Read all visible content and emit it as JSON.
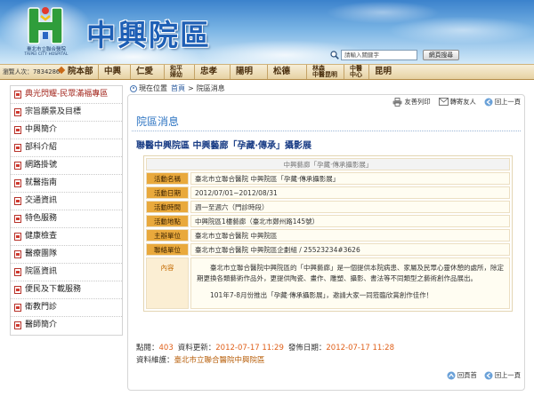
{
  "header": {
    "logo_text_zh": "臺北市立聯合醫院",
    "logo_text_en": "TAIPEI CITY HOSPITAL",
    "site_title": "中興院區",
    "search_placeholder": "請輸入關鍵字",
    "search_button": "網頁搜尋"
  },
  "nav": {
    "visit_count_label": "瀏覽人次：",
    "visit_count": "7834286",
    "items": [
      {
        "lines": [
          "院本部"
        ]
      },
      {
        "lines": [
          "中興"
        ]
      },
      {
        "lines": [
          "仁愛"
        ]
      },
      {
        "lines": [
          "和平",
          "婦幼"
        ]
      },
      {
        "lines": [
          "忠孝"
        ]
      },
      {
        "lines": [
          "陽明"
        ]
      },
      {
        "lines": [
          "松德"
        ]
      },
      {
        "lines": [
          "林森",
          "中醫昆明"
        ]
      },
      {
        "lines": [
          "中醫",
          "中心"
        ]
      },
      {
        "lines": [
          "昆明"
        ]
      }
    ]
  },
  "sidebar": {
    "items": [
      "典光閃耀-民眾滿福專區",
      "宗旨願景及目標",
      "中興簡介",
      "部科介紹",
      "網路掛號",
      "就醫指南",
      "交通資訊",
      "特色服務",
      "健康檢查",
      "醫療團隊",
      "院區資訊",
      "便民及下載服務",
      "衛教門診",
      "醫師簡介"
    ]
  },
  "breadcrumb": {
    "label": "現在位置",
    "home": "首頁",
    "separator": ">",
    "current": "院區消息"
  },
  "tools": {
    "print": "友善列印",
    "forward": "轉寄友人",
    "back": "回上一頁"
  },
  "section_heading": "院區消息",
  "article": {
    "title": "聯醫中興院區 中興藝廊「孕藏‧傳承」攝影展",
    "table_caption": "中興藝廊「孕藏‧傳承攝影展」",
    "rows": [
      {
        "label": "活動名稱",
        "value": "臺北市立聯合醫院 中興院區「孕藏‧傳承攝影展」"
      },
      {
        "label": "活動日期",
        "value": "2012/07/01~2012/08/31"
      },
      {
        "label": "活動時間",
        "value": "週一至週六（門診時段）"
      },
      {
        "label": "活動地點",
        "value": "中興院區1樓藝廊（臺北市鄭州路145號）"
      },
      {
        "label": "主辦單位",
        "value": "臺北市立聯合醫院 中興院區"
      },
      {
        "label": "聯絡單位",
        "value": "臺北市立聯合醫院 中興院區企劃組 / 25523234#3626"
      }
    ],
    "content_label": "內容",
    "content_paragraphs": [
      "臺北市立聯合醫院中興院區的「中興藝廊」是一個提供本院病患、家屬及民眾心靈休憩的處所，除定期更換各類藝術作品外，更提供陶瓷、畫作、雕塑、攝影、書法等不同類型之藝術創作品展出。",
      "101年7-8月份推出「孕藏‧傳承攝影展」，邀請大家一同蒞臨欣賞創作佳作！"
    ]
  },
  "meta": {
    "views_label": "點閱：",
    "views": "403",
    "updated_label": "資料更新：",
    "updated": "2012-07-17 11:29",
    "published_label": "發佈日期：",
    "published": "2012-07-17 11:28",
    "maintainer_label": "資料維護：",
    "maintainer": "臺北市立聯合醫院中興院區"
  },
  "footer_links": {
    "top": "回頁首",
    "back": "回上一頁"
  },
  "colors": {
    "title_blue": "#1e5fb5",
    "heading_blue": "#2d74c2",
    "label_bg": "#e9a93c",
    "highlight": "#e0601a",
    "sidebar_active": "#a3261c"
  }
}
